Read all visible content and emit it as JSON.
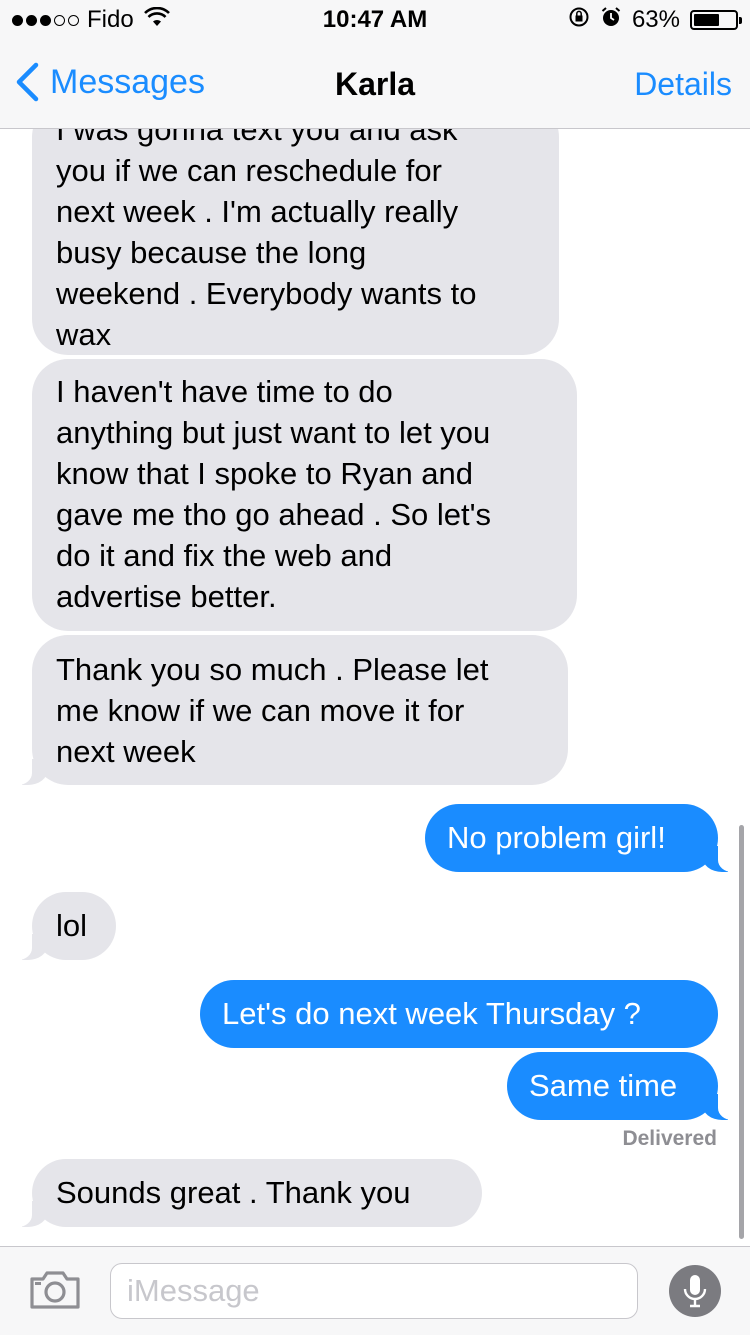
{
  "status_bar": {
    "carrier": "Fido",
    "signal_bars_filled": 3,
    "signal_bars_total": 5,
    "time": "10:47 AM",
    "battery_percent": "63%",
    "battery_level": 0.63
  },
  "nav": {
    "back_label": "Messages",
    "title": "Karla",
    "details_label": "Details"
  },
  "messages": [
    {
      "direction": "incoming",
      "text": "I was gonna text you and ask\nyou if we can reschedule for\nnext week . I'm actually really\nbusy because the long\nweekend . Everybody wants to\nwax"
    },
    {
      "direction": "incoming",
      "text": "I haven't have time to do\nanything but just want to let you\nknow that I spoke to Ryan and\ngave me tho go ahead . So let's\ndo it and fix the web and\nadvertise better."
    },
    {
      "direction": "incoming",
      "text": "Thank you so much . Please let\nme know if we can move it for\nnext week"
    },
    {
      "direction": "outgoing",
      "text": "No problem girl!"
    },
    {
      "direction": "incoming",
      "text": "lol"
    },
    {
      "direction": "outgoing",
      "text": "Let's do next week Thursday ?"
    },
    {
      "direction": "outgoing",
      "text": "Same time"
    },
    {
      "direction": "incoming",
      "text": "Sounds great . Thank you"
    }
  ],
  "delivered_label": "Delivered",
  "input": {
    "placeholder": "iMessage",
    "value": ""
  },
  "icons": {
    "back": "chevron-left-icon",
    "camera": "camera-icon",
    "mic": "microphone-icon",
    "wifi": "wifi-icon",
    "rotation_lock": "rotation-lock-icon",
    "alarm": "alarm-icon",
    "battery": "battery-icon"
  },
  "colors": {
    "accent": "#1a8cff",
    "incoming_bubble": "#e5e5ea",
    "outgoing_bubble": "#1a8cff",
    "bar_background": "#f7f7f8",
    "secondary_text": "#8e8e93"
  }
}
